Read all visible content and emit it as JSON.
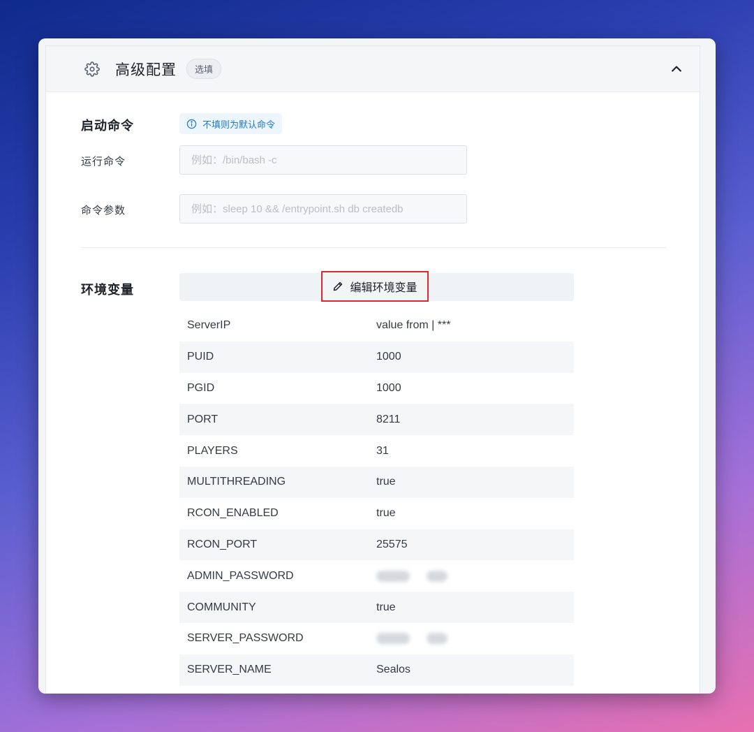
{
  "header": {
    "title": "高级配置",
    "tag": "选填",
    "icons": {
      "settings": "gear-icon",
      "collapse": "chevron-up-icon"
    }
  },
  "startup": {
    "section_label": "启动命令",
    "tip": "不填则为默认命令",
    "run_command": {
      "label": "运行命令",
      "value": "",
      "placeholder": "例如：/bin/bash -c"
    },
    "command_args": {
      "label": "命令参数",
      "value": "",
      "placeholder": "例如：sleep 10 && /entrypoint.sh db createdb"
    }
  },
  "env": {
    "section_label": "环境变量",
    "edit_button": "编辑环境变量",
    "rows": [
      {
        "key": "ServerIP",
        "value": "value from | ***"
      },
      {
        "key": "PUID",
        "value": "1000"
      },
      {
        "key": "PGID",
        "value": "1000"
      },
      {
        "key": "PORT",
        "value": "8211"
      },
      {
        "key": "PLAYERS",
        "value": "31"
      },
      {
        "key": "MULTITHREADING",
        "value": "true"
      },
      {
        "key": "RCON_ENABLED",
        "value": "true"
      },
      {
        "key": "RCON_PORT",
        "value": "25575"
      },
      {
        "key": "ADMIN_PASSWORD",
        "value": null,
        "blurred": true
      },
      {
        "key": "COMMUNITY",
        "value": "true"
      },
      {
        "key": "SERVER_PASSWORD",
        "value": null,
        "blurred": true
      },
      {
        "key": "SERVER_NAME",
        "value": "Sealos"
      }
    ]
  },
  "colors": {
    "highlight_border": "#e0262b",
    "tip_text": "#2079c9",
    "tip_bg": "#eef6fd"
  }
}
